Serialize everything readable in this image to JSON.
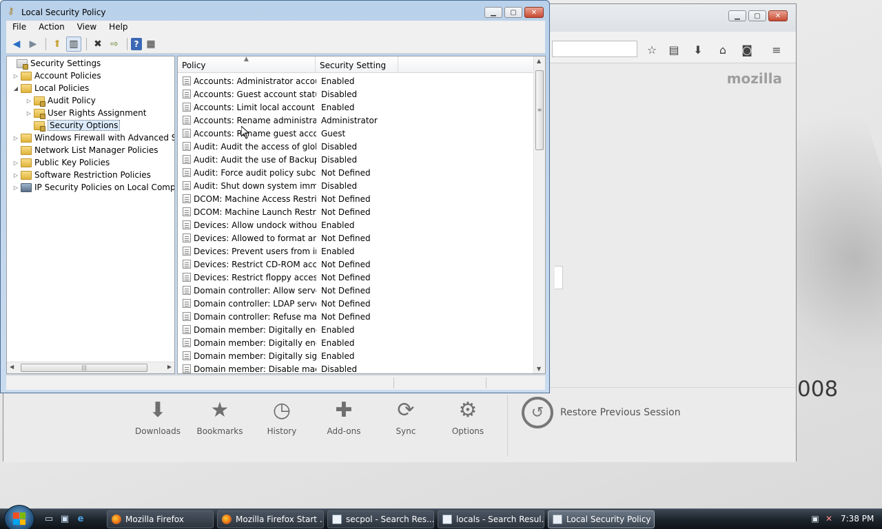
{
  "lsp": {
    "title": "Local Security Policy",
    "menu": [
      "File",
      "Action",
      "View",
      "Help"
    ],
    "tree": [
      {
        "label": "Security Settings",
        "indent": 0,
        "expander": "",
        "icon": "security-settings-icon",
        "selected": false
      },
      {
        "label": "Account Policies",
        "indent": 1,
        "expander": "▷",
        "icon": "folder-icon",
        "selected": false
      },
      {
        "label": "Local Policies",
        "indent": 1,
        "expander": "◢",
        "icon": "folder-icon",
        "selected": false
      },
      {
        "label": "Audit Policy",
        "indent": 2,
        "expander": "▷",
        "icon": "policy-folder-icon",
        "selected": false
      },
      {
        "label": "User Rights Assignment",
        "indent": 2,
        "expander": "▷",
        "icon": "policy-folder-icon",
        "selected": false
      },
      {
        "label": "Security Options",
        "indent": 2,
        "expander": "",
        "icon": "policy-folder-icon",
        "selected": true
      },
      {
        "label": "Windows Firewall with Advanced Secu",
        "indent": 1,
        "expander": "▷",
        "icon": "folder-icon",
        "selected": false
      },
      {
        "label": "Network List Manager Policies",
        "indent": 1,
        "expander": "",
        "icon": "folder-icon",
        "selected": false
      },
      {
        "label": "Public Key Policies",
        "indent": 1,
        "expander": "▷",
        "icon": "folder-icon",
        "selected": false
      },
      {
        "label": "Software Restriction Policies",
        "indent": 1,
        "expander": "▷",
        "icon": "folder-icon",
        "selected": false
      },
      {
        "label": "IP Security Policies on Local Compute",
        "indent": 1,
        "expander": "▷",
        "icon": "ipsec-shield-icon",
        "selected": false
      }
    ],
    "columns": [
      "Policy",
      "Security Setting"
    ],
    "rows": [
      {
        "policy": "Accounts: Administrator accou...",
        "setting": "Enabled"
      },
      {
        "policy": "Accounts: Guest account status",
        "setting": "Disabled"
      },
      {
        "policy": "Accounts: Limit local account u...",
        "setting": "Enabled"
      },
      {
        "policy": "Accounts: Rename administrat...",
        "setting": "Administrator"
      },
      {
        "policy": "Accounts: Rename guest accou...",
        "setting": "Guest"
      },
      {
        "policy": "Audit: Audit the access of glob...",
        "setting": "Disabled"
      },
      {
        "policy": "Audit: Audit the use of Backup ...",
        "setting": "Disabled"
      },
      {
        "policy": "Audit: Force audit policy subcat...",
        "setting": "Not Defined"
      },
      {
        "policy": "Audit: Shut down system imme...",
        "setting": "Disabled"
      },
      {
        "policy": "DCOM: Machine Access Restric...",
        "setting": "Not Defined"
      },
      {
        "policy": "DCOM: Machine Launch Restri...",
        "setting": "Not Defined"
      },
      {
        "policy": "Devices: Allow undock without ...",
        "setting": "Enabled"
      },
      {
        "policy": "Devices: Allowed to format and...",
        "setting": "Not Defined"
      },
      {
        "policy": "Devices: Prevent users from inst...",
        "setting": "Enabled"
      },
      {
        "policy": "Devices: Restrict CD-ROM acce...",
        "setting": "Not Defined"
      },
      {
        "policy": "Devices: Restrict floppy access t...",
        "setting": "Not Defined"
      },
      {
        "policy": "Domain controller: Allow server...",
        "setting": "Not Defined"
      },
      {
        "policy": "Domain controller: LDAP server...",
        "setting": "Not Defined"
      },
      {
        "policy": "Domain controller: Refuse mac...",
        "setting": "Not Defined"
      },
      {
        "policy": "Domain member: Digitally encr...",
        "setting": "Enabled"
      },
      {
        "policy": "Domain member: Digitally encr...",
        "setting": "Enabled"
      },
      {
        "policy": "Domain member: Digitally sign ...",
        "setting": "Enabled"
      },
      {
        "policy": "Domain member: Disable mach...",
        "setting": "Disabled"
      }
    ]
  },
  "firefox": {
    "brand": "mozilla",
    "year_fragment": "008",
    "launcher": [
      {
        "label": "Downloads",
        "icon": "download-arrow-icon",
        "glyph": "⬇"
      },
      {
        "label": "Bookmarks",
        "icon": "star-icon",
        "glyph": "★"
      },
      {
        "label": "History",
        "icon": "clock-icon",
        "glyph": "◷"
      },
      {
        "label": "Add-ons",
        "icon": "puzzle-icon",
        "glyph": "✚"
      },
      {
        "label": "Sync",
        "icon": "sync-icon",
        "glyph": "⟳"
      },
      {
        "label": "Options",
        "icon": "gear-icon",
        "glyph": "⚙"
      }
    ],
    "restore_label": "Restore Previous Session"
  },
  "taskbar": {
    "items": [
      {
        "label": "Mozilla Firefox",
        "icon": "firefox-icon",
        "active": false
      },
      {
        "label": "Mozilla Firefox Start ...",
        "icon": "firefox-icon",
        "active": false
      },
      {
        "label": "secpol - Search Res...",
        "icon": "search-results-icon",
        "active": false
      },
      {
        "label": "locals - Search Resul...",
        "icon": "search-results-icon",
        "active": false
      },
      {
        "label": "Local Security Policy",
        "icon": "local-security-policy-icon",
        "active": true
      }
    ],
    "clock": "7:38 PM"
  }
}
